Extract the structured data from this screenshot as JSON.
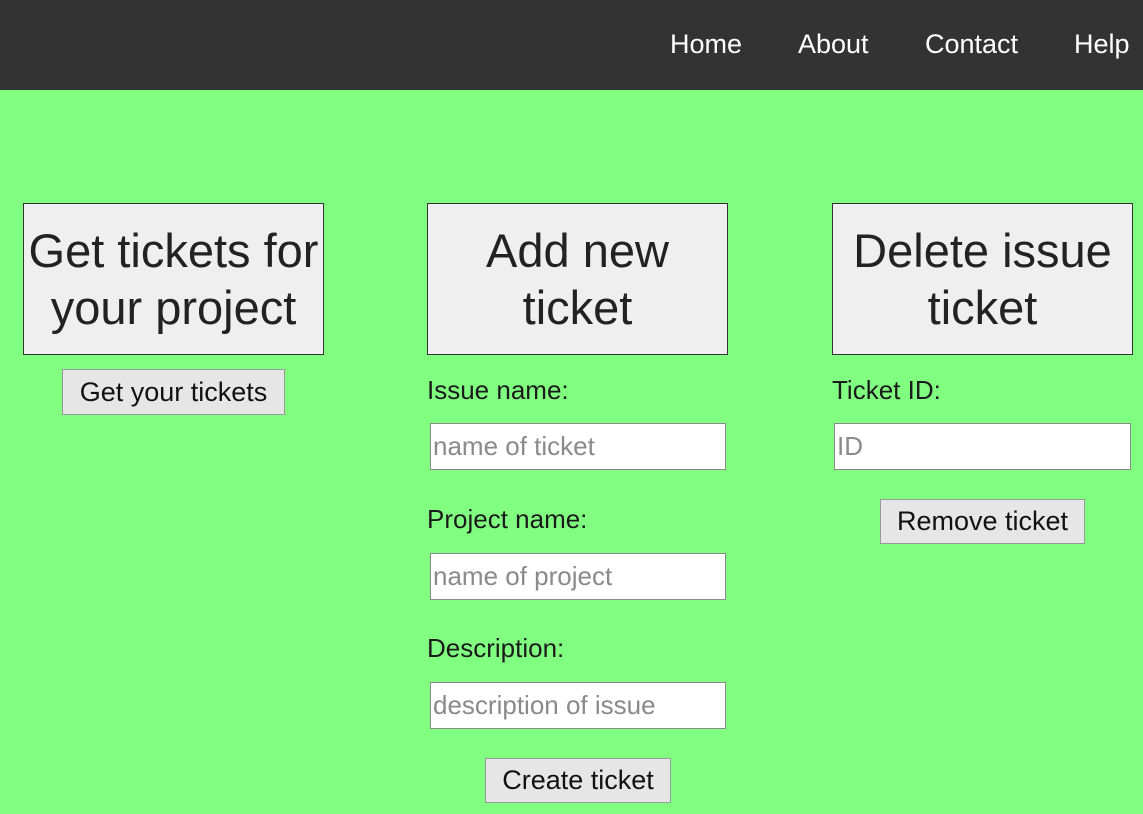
{
  "nav": {
    "home": "Home",
    "about": "About",
    "contact": "Contact",
    "help": "Help"
  },
  "get_panel": {
    "title_line1": "Get tickets for",
    "title_line2": "your project",
    "button": "Get your tickets"
  },
  "add_panel": {
    "title_line1": "Add new",
    "title_line2": "ticket",
    "issue_label": "Issue name:",
    "issue_placeholder": "name of ticket",
    "project_label": "Project name:",
    "project_placeholder": "name of project",
    "description_label": "Description:",
    "description_placeholder": "description of issue",
    "button": "Create ticket"
  },
  "delete_panel": {
    "title_line1": "Delete issue",
    "title_line2": "ticket",
    "id_label": "Ticket ID:",
    "id_placeholder": "ID",
    "button": "Remove ticket"
  },
  "colors": {
    "background": "#80ff80",
    "navbar": "#333333",
    "card": "#efefef"
  }
}
